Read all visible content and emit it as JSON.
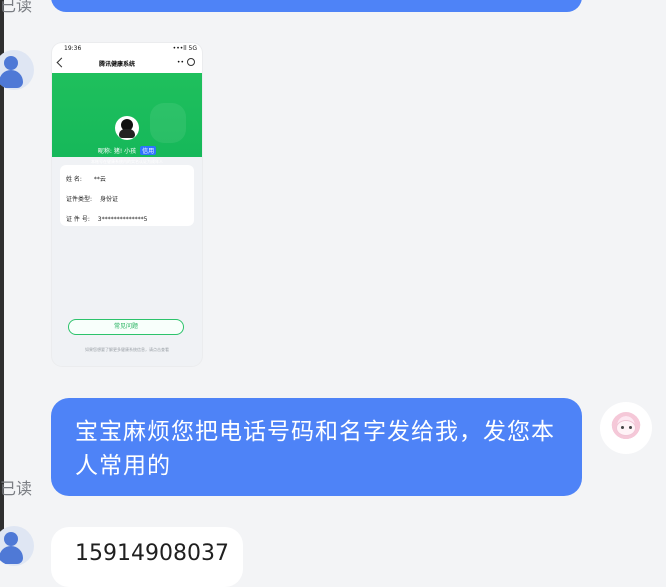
{
  "read_labels": [
    "已读",
    "已读"
  ],
  "phone_screen": {
    "time": "19:36",
    "status": "•••ll 5G",
    "title": "腾讯健康系统",
    "more": "•• ",
    "profile_name": "昵称: 猪! 小孩",
    "profile_badge": "信用",
    "profile_sub": "本账号在健康系统内的实名认证为成年人",
    "info": {
      "name_label": "姓 名:",
      "name_value": "**云",
      "id_type_label": "证件类型:",
      "id_type_value": "身份证",
      "id_no_label": "证 件 号:",
      "id_no_value": "3**************5"
    },
    "faq": "常见问题",
    "footer": "如果您想要了解更多健康系统信息，请点击查看"
  },
  "messages": {
    "main_bubble": "宝宝麻烦您把电话号码和名字发给我，发您本人常用的",
    "phone_bubble": "15914908037"
  }
}
